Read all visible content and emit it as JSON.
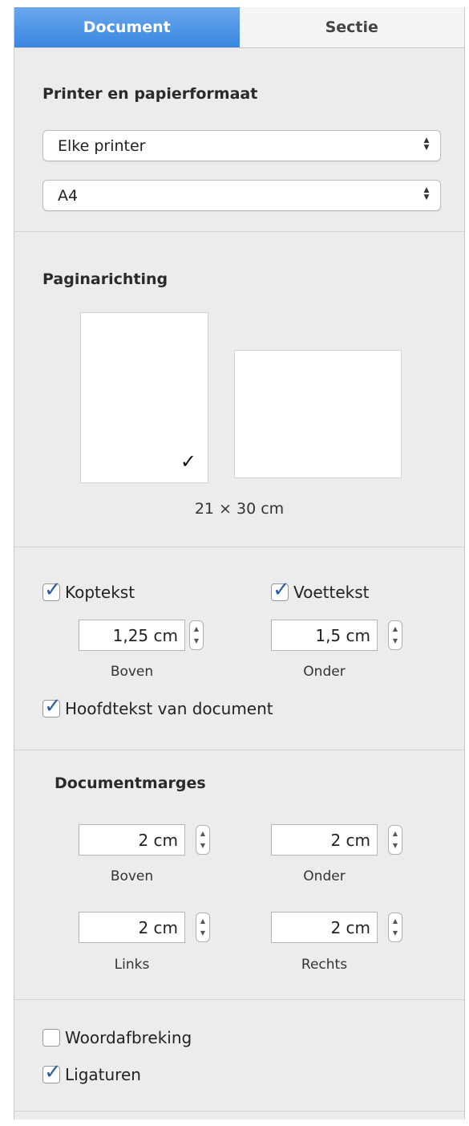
{
  "tabs": {
    "document": "Document",
    "section": "Sectie"
  },
  "printer_section": {
    "heading": "Printer en papierformaat",
    "printer_select": "Elke printer",
    "paper_select": "A4"
  },
  "orientation": {
    "heading": "Paginarichting",
    "selected": "portrait",
    "check_glyph": "✓",
    "dimensions": "21 × 30 cm"
  },
  "header_footer": {
    "header_label": "Koptekst",
    "header_checked": true,
    "footer_label": "Voettekst",
    "footer_checked": true,
    "header_value": "1,25 cm",
    "header_caption": "Boven",
    "footer_value": "1,5 cm",
    "footer_caption": "Onder",
    "body_label": "Hoofdtekst van document",
    "body_checked": true
  },
  "margins": {
    "heading": "Documentmarges",
    "top_value": "2 cm",
    "top_caption": "Boven",
    "bottom_value": "2 cm",
    "bottom_caption": "Onder",
    "left_value": "2 cm",
    "left_caption": "Links",
    "right_value": "2 cm",
    "right_caption": "Rechts"
  },
  "options": {
    "hyphenation_label": "Woordafbreking",
    "hyphenation_checked": false,
    "ligatures_label": "Ligaturen",
    "ligatures_checked": true
  },
  "glyphs": {
    "tick": "✓",
    "arrow_up": "▲",
    "arrow_down": "▼"
  },
  "colors": {
    "active_tab": "#3a86e0",
    "checkbox_tick": "#2a5fa8",
    "panel_bg": "#ececec"
  }
}
